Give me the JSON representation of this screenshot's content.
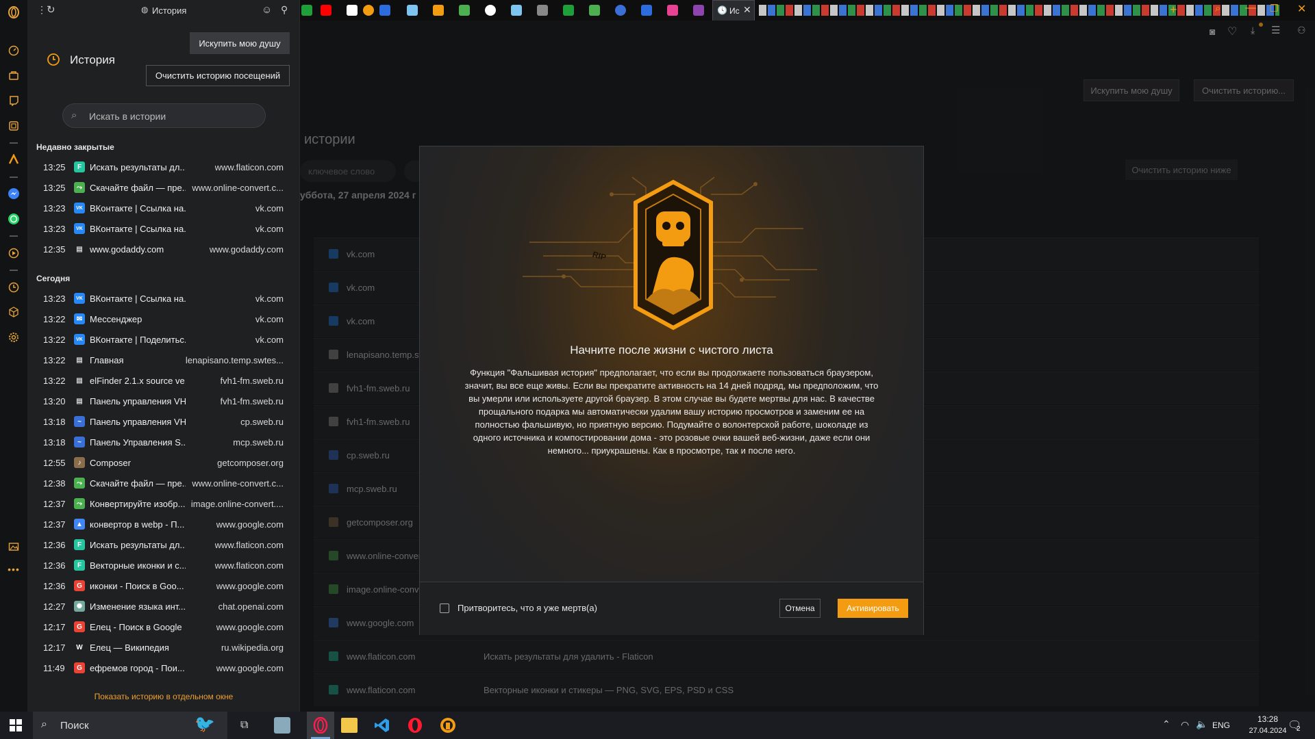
{
  "browser": {
    "sidebar_tab_title": "История",
    "page_title": "История",
    "active_tab_label": "Ис",
    "redeem_button": "Искупить мою душу",
    "clear_visits_button": "Очистить историю посещений",
    "search_placeholder": "Искать в истории",
    "show_in_window_link": "Показать историю в отдельном окне"
  },
  "recently_closed": {
    "header": "Недавно закрытые",
    "items": [
      {
        "time": "13:25",
        "title": "Искать результаты дл...",
        "domain": "www.flaticon.com",
        "icon": "flaticon-icon",
        "color": "#27c4a0"
      },
      {
        "time": "13:25",
        "title": "Скачайте файл — пре...",
        "domain": "www.online-convert.c...",
        "icon": "convert-icon",
        "color": "#4caf50"
      },
      {
        "time": "13:23",
        "title": "ВКонтакте | Ссылка на...",
        "domain": "vk.com",
        "icon": "vk-icon",
        "color": "#2787f5"
      },
      {
        "time": "13:23",
        "title": "ВКонтакте | Ссылка на...",
        "domain": "vk.com",
        "icon": "vk-icon",
        "color": "#2787f5"
      },
      {
        "time": "12:35",
        "title": "www.godaddy.com",
        "domain": "www.godaddy.com",
        "icon": "page-icon",
        "color": "#cfcfcf"
      }
    ]
  },
  "today": {
    "header": "Сегодня",
    "items": [
      {
        "time": "13:23",
        "title": "ВКонтакте | Ссылка на...",
        "domain": "vk.com",
        "icon": "vk-icon",
        "color": "#2787f5"
      },
      {
        "time": "13:22",
        "title": "Мессенджер",
        "domain": "vk.com",
        "icon": "messenger-icon",
        "color": "#2787f5"
      },
      {
        "time": "13:22",
        "title": "ВКонтакте | Поделитьс...",
        "domain": "vk.com",
        "icon": "vk-icon",
        "color": "#2787f5"
      },
      {
        "time": "13:22",
        "title": "Главная",
        "domain": "lenapisano.temp.swtes...",
        "icon": "page-icon",
        "color": "#cfcfcf"
      },
      {
        "time": "13:22",
        "title": "elFinder 2.1.x source ve...",
        "domain": "fvh1-fm.sweb.ru",
        "icon": "page-icon",
        "color": "#cfcfcf"
      },
      {
        "time": "13:20",
        "title": "Панель управления VH",
        "domain": "fvh1-fm.sweb.ru",
        "icon": "page-icon",
        "color": "#cfcfcf"
      },
      {
        "time": "13:18",
        "title": "Панель управления VH",
        "domain": "cp.sweb.ru",
        "icon": "sweb-icon",
        "color": "#3a6fd8"
      },
      {
        "time": "13:18",
        "title": "Панель Управления S...",
        "domain": "mcp.sweb.ru",
        "icon": "sweb-icon",
        "color": "#3a6fd8"
      },
      {
        "time": "12:55",
        "title": "Composer",
        "domain": "getcomposer.org",
        "icon": "composer-icon",
        "color": "#8a6d4a"
      },
      {
        "time": "12:38",
        "title": "Скачайте файл — пре...",
        "domain": "www.online-convert.c...",
        "icon": "convert-icon",
        "color": "#4caf50"
      },
      {
        "time": "12:37",
        "title": "Конвертируйте изобр...",
        "domain": "image.online-convert....",
        "icon": "convert-icon",
        "color": "#4caf50"
      },
      {
        "time": "12:37",
        "title": "конвертор в webp - П...",
        "domain": "www.google.com",
        "icon": "google-ads-icon",
        "color": "#4285f4"
      },
      {
        "time": "12:36",
        "title": "Искать результаты дл...",
        "domain": "www.flaticon.com",
        "icon": "flaticon-icon",
        "color": "#27c4a0"
      },
      {
        "time": "12:36",
        "title": "Векторные иконки и с...",
        "domain": "www.flaticon.com",
        "icon": "flaticon-icon",
        "color": "#27c4a0"
      },
      {
        "time": "12:36",
        "title": "иконки - Поиск в Goo...",
        "domain": "www.google.com",
        "icon": "google-icon",
        "color": "#ea4335"
      },
      {
        "time": "12:27",
        "title": "Изменение языка инт...",
        "domain": "chat.openai.com",
        "icon": "openai-icon",
        "color": "#74aa9c"
      },
      {
        "time": "12:17",
        "title": "Елец - Поиск в Google",
        "domain": "www.google.com",
        "icon": "google-icon",
        "color": "#ea4335"
      },
      {
        "time": "12:17",
        "title": "Елец — Википедия",
        "domain": "ru.wikipedia.org",
        "icon": "wikipedia-icon",
        "color": "#ffffff"
      },
      {
        "time": "11:49",
        "title": "ефремов город - Пои...",
        "domain": "www.google.com",
        "icon": "google-icon",
        "color": "#ea4335"
      }
    ]
  },
  "main_page": {
    "title": "истории",
    "search_placeholder": "ключевое слово",
    "redeem_button": "Искупить мою душу",
    "clear_button": "Очистить историю...",
    "clear_below_button": "Очистить историю ниже",
    "date_header": "уббота, 27 апреля 2024 г",
    "rows": [
      {
        "domain": "vk.com",
        "title": "",
        "color": "#2787f5"
      },
      {
        "domain": "vk.com",
        "title": "",
        "color": "#2787f5"
      },
      {
        "domain": "vk.com",
        "title": "",
        "color": "#2787f5"
      },
      {
        "domain": "lenapisano.temp.swtes",
        "title": "",
        "color": "#9a9a9a"
      },
      {
        "domain": "fvh1-fm.sweb.ru",
        "title": "",
        "color": "#9a9a9a"
      },
      {
        "domain": "fvh1-fm.sweb.ru",
        "title": "",
        "color": "#9a9a9a"
      },
      {
        "domain": "cp.sweb.ru",
        "title": "",
        "color": "#3a6fd8"
      },
      {
        "domain": "mcp.sweb.ru",
        "title": "",
        "color": "#3a6fd8"
      },
      {
        "domain": "getcomposer.org",
        "title": "",
        "color": "#8a6d4a"
      },
      {
        "domain": "www.online-convert.c",
        "title": "",
        "color": "#4caf50"
      },
      {
        "domain": "image.online-convert.",
        "title": "",
        "color": "#4caf50"
      },
      {
        "domain": "www.google.com",
        "title": "",
        "color": "#4285f4"
      },
      {
        "domain": "www.flaticon.com",
        "title": "Искать результаты для удалить - Flaticon",
        "color": "#27c4a0"
      },
      {
        "domain": "www.flaticon.com",
        "title": "Векторные иконки и стикеры — PNG, SVG, EPS, PSD и CSS",
        "color": "#27c4a0"
      }
    ]
  },
  "modal": {
    "badge_text": "RIP",
    "heading": "Начните после жизни с чистого листа",
    "body": "Функция \"Фальшивая история\" предполагает, что если вы продолжаете пользоваться браузером, значит, вы все еще живы. Если вы прекратите активность на 14 дней подряд, мы предположим, что вы умерли или используете другой браузер. В этом случае вы будете мертвы для нас. В качестве прощального подарка мы автоматически удалим вашу историю просмотров и заменим ее на полностью фальшивую, но приятную версию. Подумайте о волонтерской работе, шоколаде из одного источника и компостировании дома - это розовые очки вашей веб-жизни, даже если они немного... приукрашены. Как в просмотре, так и после него.",
    "checkbox_label": "Притворитесь, что я уже мертв(а)",
    "checkbox_checked": false,
    "cancel_button": "Отмена",
    "activate_button": "Активировать"
  },
  "taskbar": {
    "search_placeholder": "Поиск",
    "language": "ENG",
    "time": "13:28",
    "date": "27.04.2024",
    "notifications": "2"
  },
  "colors": {
    "accent": "#f39c12",
    "link": "#f0a030"
  }
}
